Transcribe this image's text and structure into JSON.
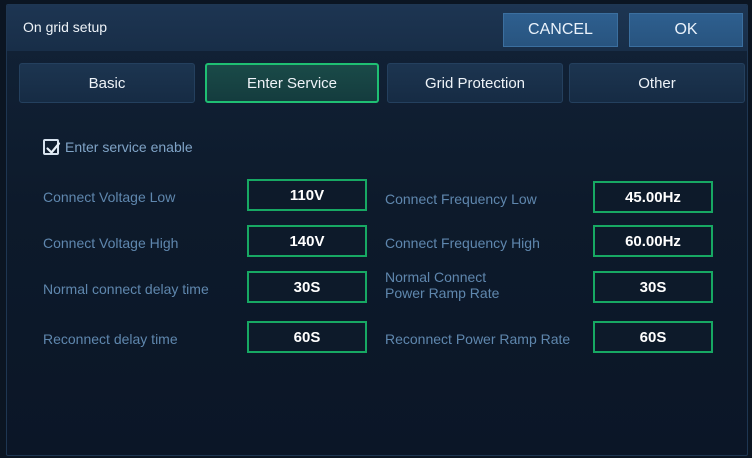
{
  "header": {
    "title": "On grid setup",
    "cancel_label": "CANCEL",
    "ok_label": "OK"
  },
  "tabs": [
    {
      "label": "Basic",
      "active": false
    },
    {
      "label": "Enter Service",
      "active": true
    },
    {
      "label": "Grid Protection",
      "active": false
    },
    {
      "label": "Other",
      "active": false
    }
  ],
  "enter_service": {
    "enable_label": "Enter service enable",
    "enable_checked": true,
    "left": [
      {
        "label": "Connect Voltage Low",
        "value": "110V"
      },
      {
        "label": "Connect Voltage High",
        "value": "140V"
      },
      {
        "label": "Normal connect delay time",
        "value": "30S"
      },
      {
        "label": "Reconnect delay time",
        "value": "60S"
      }
    ],
    "right": [
      {
        "label": "Connect Frequency Low",
        "value": "45.00Hz"
      },
      {
        "label": "Connect Frequency High",
        "value": "60.00Hz"
      },
      {
        "label_line1": "Normal Connect",
        "label_line2": "Power Ramp Rate",
        "value": "30S"
      },
      {
        "label": "Reconnect Power Ramp Rate",
        "value": "60S"
      }
    ]
  },
  "colors": {
    "accent_green": "#1fbf73",
    "button_blue": "#2e5f8f",
    "label_blue": "#5f87ae"
  }
}
